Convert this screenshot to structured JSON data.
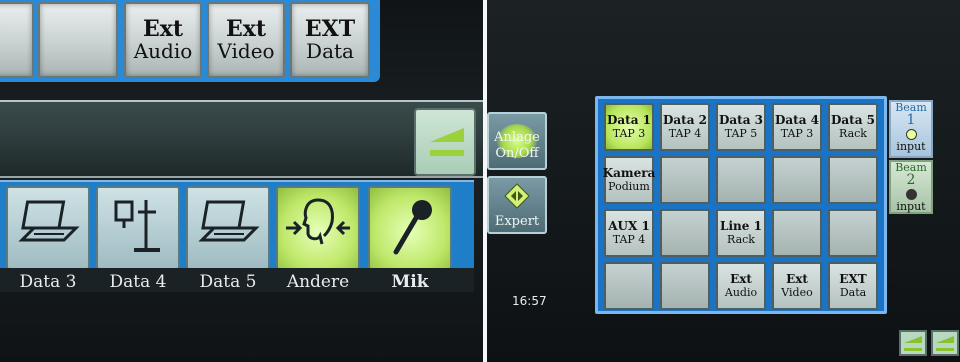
{
  "left_panel": {
    "top_row": [
      {
        "line1": "Ext",
        "line2": "Audio"
      },
      {
        "line1": "Ext",
        "line2": "Video"
      },
      {
        "line1": "EXT",
        "line2": "Data"
      }
    ],
    "icon_row": [
      {
        "label": "Data 3",
        "icon": "laptop-icon"
      },
      {
        "label": "Data 4",
        "icon": "document-camera-icon"
      },
      {
        "label": "Data 5",
        "icon": "laptop-icon"
      },
      {
        "label": "Andere",
        "icon": "person-listening-icon"
      },
      {
        "label": "Mik",
        "icon": "microphone-icon"
      }
    ]
  },
  "right_panel": {
    "side_buttons": {
      "anlage": {
        "line1": "Anlage",
        "line2": "On/Off"
      },
      "expert": {
        "label": "Expert"
      }
    },
    "grid": [
      [
        {
          "line1": "Data 1",
          "line2": "TAP 3",
          "selected": true
        },
        {
          "line1": "Data 2",
          "line2": "TAP 4"
        },
        {
          "line1": "Data 3",
          "line2": "TAP 5"
        },
        {
          "line1": "Data 4",
          "line2": "TAP 3"
        },
        {
          "line1": "Data 5",
          "line2": "Rack"
        }
      ],
      [
        {
          "line1": "Kamera",
          "line2": "Podium"
        },
        {
          "line1": "",
          "line2": ""
        },
        {
          "line1": "",
          "line2": ""
        },
        {
          "line1": "",
          "line2": ""
        },
        {
          "line1": "",
          "line2": ""
        }
      ],
      [
        {
          "line1": "AUX 1",
          "line2": "TAP 4"
        },
        {
          "line1": "",
          "line2": ""
        },
        {
          "line1": "Line 1",
          "line2": "Rack"
        },
        {
          "line1": "",
          "line2": ""
        },
        {
          "line1": "",
          "line2": ""
        }
      ],
      [
        {
          "line1": "",
          "line2": ""
        },
        {
          "line1": "",
          "line2": ""
        },
        {
          "line1": "Ext",
          "line2": "Audio"
        },
        {
          "line1": "Ext",
          "line2": "Video"
        },
        {
          "line1": "EXT",
          "line2": "Data"
        }
      ]
    ],
    "beam1": {
      "word": "Beam",
      "number": "1",
      "sub": "input",
      "dot_color": "#e8ff9a"
    },
    "beam2": {
      "word": "Beam",
      "number": "2",
      "sub": "input",
      "dot_color": "#333333"
    },
    "clock": "16:57"
  },
  "colors": {
    "frame_blue": "#1f7ec8",
    "active_green": "#b7e55c"
  }
}
